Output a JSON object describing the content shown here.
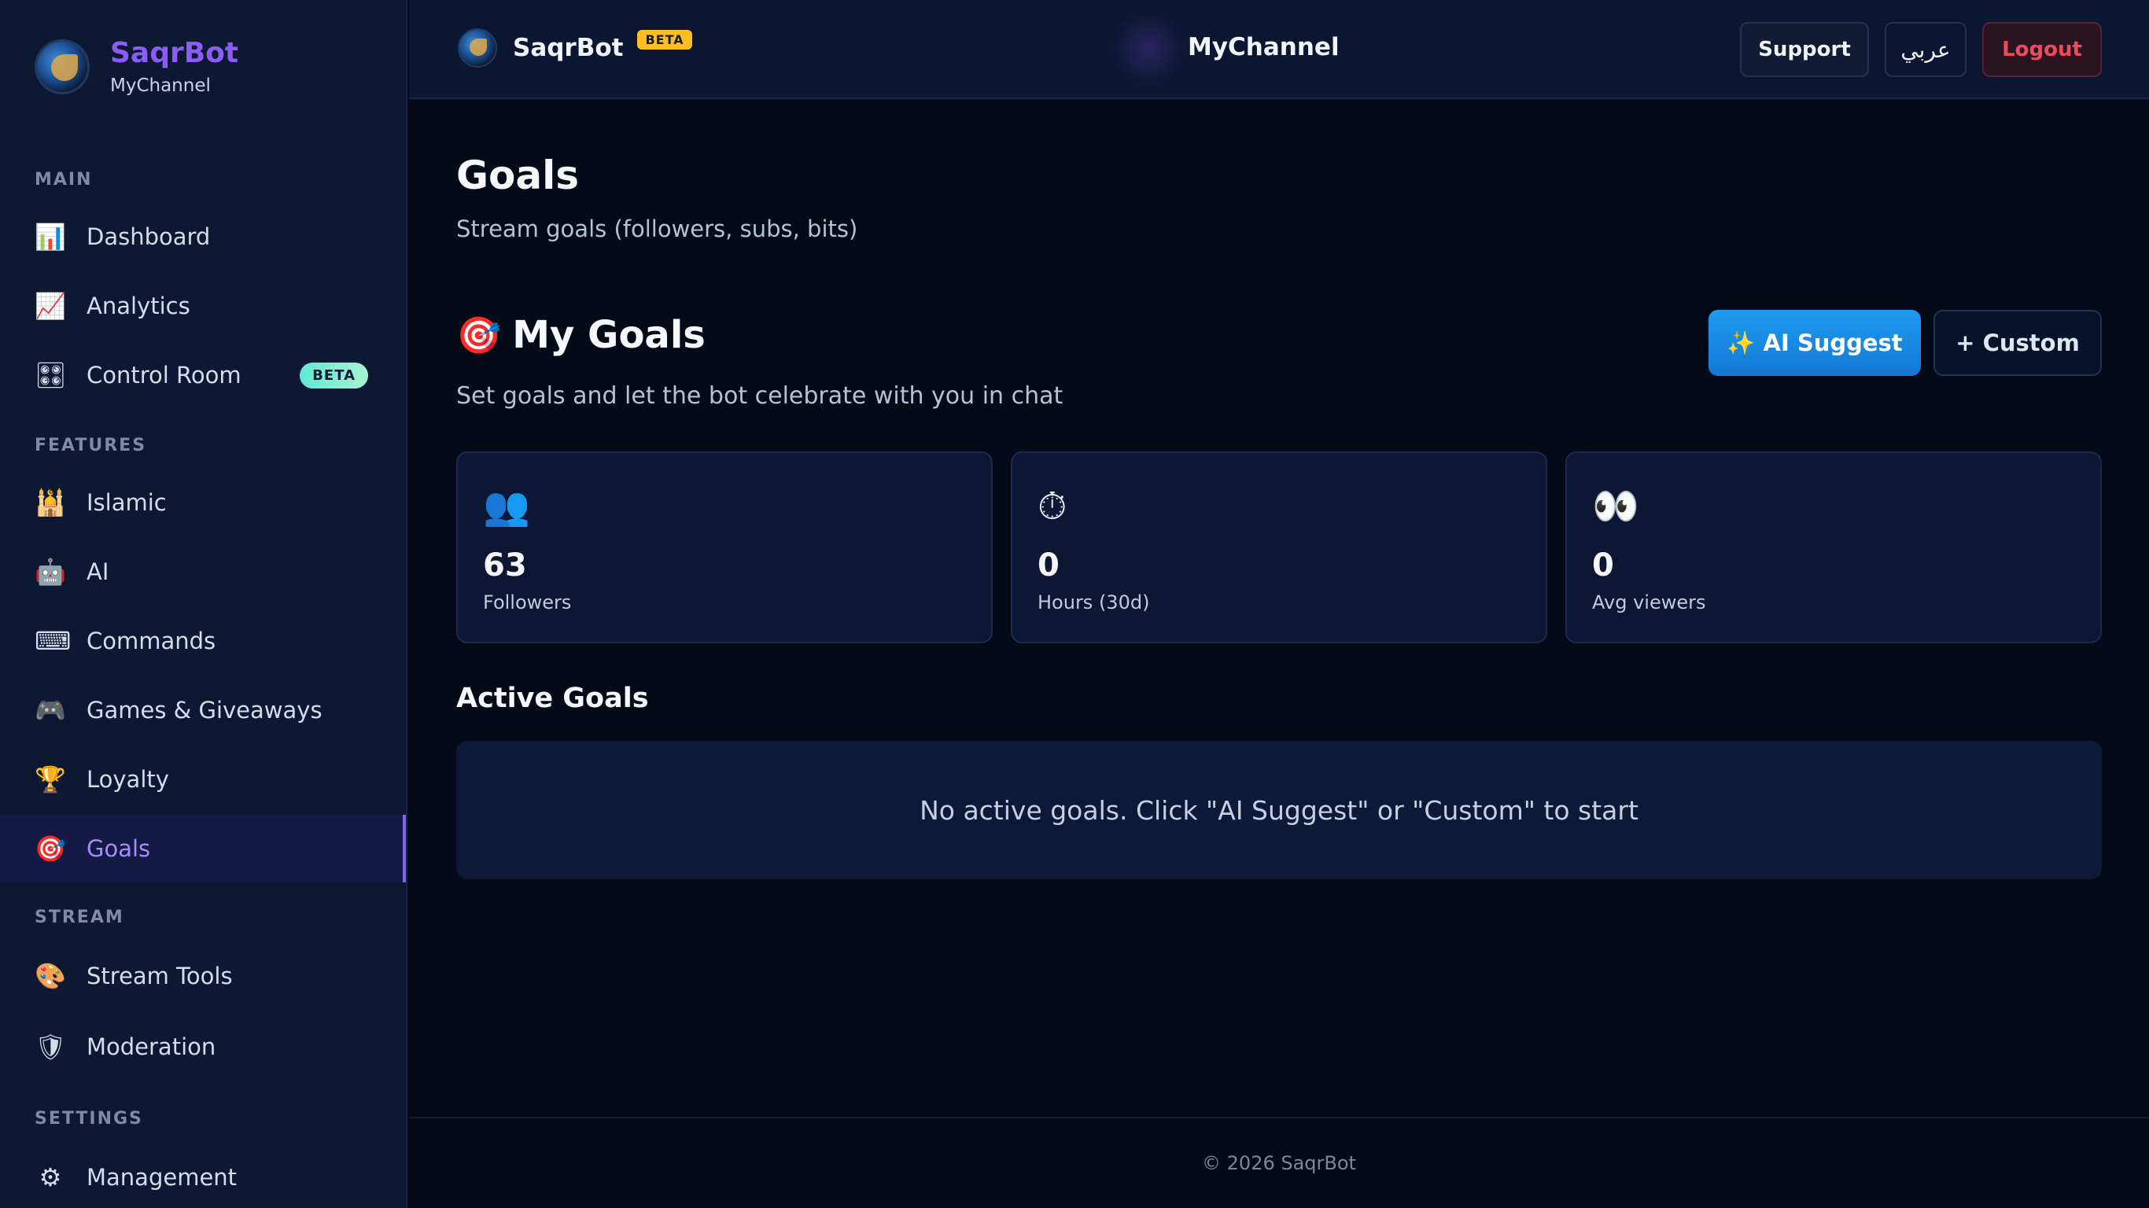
{
  "sidebar": {
    "brand": {
      "name": "SaqrBot",
      "channel": "MyChannel"
    },
    "sections": {
      "main": "MAIN",
      "features": "FEATURES",
      "stream": "STREAM",
      "settings": "SETTINGS"
    },
    "items": [
      {
        "label": "Dashboard",
        "icon": "📊"
      },
      {
        "label": "Analytics",
        "icon": "📈"
      },
      {
        "label": "Control Room",
        "icon": "🎛",
        "badge": "BETA"
      },
      {
        "label": "Islamic",
        "icon": "🕌"
      },
      {
        "label": "AI",
        "icon": "🤖"
      },
      {
        "label": "Commands",
        "icon": "⌨"
      },
      {
        "label": "Games & Giveaways",
        "icon": "🎮"
      },
      {
        "label": "Loyalty",
        "icon": "🏆"
      },
      {
        "label": "Goals",
        "icon": "🎯"
      },
      {
        "label": "Stream Tools",
        "icon": "🎨"
      },
      {
        "label": "Moderation",
        "icon": "🛡"
      },
      {
        "label": "Management",
        "icon": "⚙"
      }
    ],
    "active_item": "Goals"
  },
  "topbar": {
    "brand": "SaqrBot",
    "beta": "BETA",
    "channel": "MyChannel",
    "support": "Support",
    "language": "عربي",
    "logout": "Logout"
  },
  "page": {
    "title": "Goals",
    "subtitle": "Stream goals (followers, subs, bits)",
    "section_icon": "🎯",
    "section_title": "My Goals",
    "section_subtitle": "Set goals and let the bot celebrate with you in chat",
    "ai_button": "✨ AI Suggest",
    "custom_button": "+ Custom",
    "stats": [
      {
        "icon": "👥",
        "value": "63",
        "label": "Followers"
      },
      {
        "icon": "⏱",
        "value": "0",
        "label": "Hours (30d)"
      },
      {
        "icon": "👀",
        "value": "0",
        "label": "Avg viewers"
      }
    ],
    "active_title": "Active Goals",
    "empty_message": "No active goals. Click \"AI Suggest\" or \"Custom\" to start"
  },
  "footer": {
    "text": "© 2026 SaqrBot"
  },
  "colors": {
    "accent": "#8b5cf6",
    "primary_button": "#1e9bf0",
    "logout": "#f04a5e",
    "beta": "#fbbf24"
  }
}
